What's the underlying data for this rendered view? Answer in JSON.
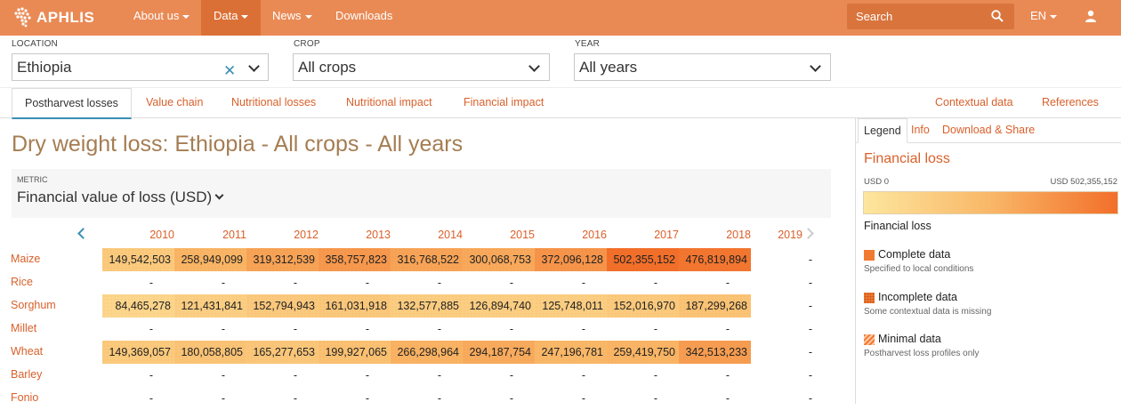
{
  "brand": {
    "name": "APHLIS"
  },
  "nav": {
    "items": [
      {
        "label": "About us",
        "dropdown": true
      },
      {
        "label": "Data",
        "dropdown": true,
        "active": true
      },
      {
        "label": "News",
        "dropdown": true
      },
      {
        "label": "Downloads",
        "dropdown": false
      }
    ],
    "search_placeholder": "Search",
    "language": "EN"
  },
  "filters": {
    "location": {
      "label": "LOCATION",
      "value": "Ethiopia"
    },
    "crop": {
      "label": "CROP",
      "value": "All crops"
    },
    "year": {
      "label": "YEAR",
      "value": "All years"
    }
  },
  "tabs": {
    "left": [
      "Postharvest losses",
      "Value chain",
      "Nutritional losses",
      "Nutritional impact",
      "Financial impact"
    ],
    "right": [
      "Contextual data",
      "References"
    ]
  },
  "main": {
    "title": "Dry weight loss: Ethiopia - All crops - All years",
    "metric_label": "METRIC",
    "metric_value": "Financial value of loss (USD)"
  },
  "table": {
    "years": [
      "2010",
      "2011",
      "2012",
      "2013",
      "2014",
      "2015",
      "2016",
      "2017",
      "2018",
      "2019"
    ],
    "rows": [
      {
        "crop": "Maize",
        "values": [
          "149,542,503",
          "258,949,099",
          "319,312,539",
          "358,757,823",
          "316,768,522",
          "300,068,753",
          "372,096,128",
          "502,355,152",
          "476,819,894",
          "-"
        ],
        "raw": [
          149542503,
          258949099,
          319312539,
          358757823,
          316768522,
          300068753,
          372096128,
          502355152,
          476819894,
          null
        ]
      },
      {
        "crop": "Rice",
        "values": [
          "-",
          "-",
          "-",
          "-",
          "-",
          "-",
          "-",
          "-",
          "-",
          "-"
        ],
        "raw": [
          null,
          null,
          null,
          null,
          null,
          null,
          null,
          null,
          null,
          null
        ]
      },
      {
        "crop": "Sorghum",
        "values": [
          "84,465,278",
          "121,431,841",
          "152,794,943",
          "161,031,918",
          "132,577,885",
          "126,894,740",
          "125,748,011",
          "152,016,970",
          "187,299,268",
          "-"
        ],
        "raw": [
          84465278,
          121431841,
          152794943,
          161031918,
          132577885,
          126894740,
          125748011,
          152016970,
          187299268,
          null
        ]
      },
      {
        "crop": "Millet",
        "values": [
          "-",
          "-",
          "-",
          "-",
          "-",
          "-",
          "-",
          "-",
          "-",
          "-"
        ],
        "raw": [
          null,
          null,
          null,
          null,
          null,
          null,
          null,
          null,
          null,
          null
        ]
      },
      {
        "crop": "Wheat",
        "values": [
          "149,369,057",
          "180,058,805",
          "165,277,653",
          "199,927,065",
          "266,298,964",
          "294,187,754",
          "247,196,781",
          "259,419,750",
          "342,513,233",
          "-"
        ],
        "raw": [
          149369057,
          180058805,
          165277653,
          199927065,
          266298964,
          294187754,
          247196781,
          259419750,
          342513233,
          null
        ]
      },
      {
        "crop": "Barley",
        "values": [
          "-",
          "-",
          "-",
          "-",
          "-",
          "-",
          "-",
          "-",
          "-",
          "-"
        ],
        "raw": [
          null,
          null,
          null,
          null,
          null,
          null,
          null,
          null,
          null,
          null
        ]
      },
      {
        "crop": "Fonio",
        "values": [
          "-",
          "-",
          "-",
          "-",
          "-",
          "-",
          "-",
          "-",
          "-",
          "-"
        ],
        "raw": [
          null,
          null,
          null,
          null,
          null,
          null,
          null,
          null,
          null,
          null
        ]
      }
    ],
    "scale_min": 0,
    "scale_max": 502355152
  },
  "legend": {
    "tabs": [
      "Legend",
      "Info",
      "Download & Share"
    ],
    "title": "Financial loss",
    "scale_low": "USD 0",
    "scale_high": "USD 502,355,152",
    "scale_caption": "Financial loss",
    "colors": {
      "low": "#fde69e",
      "mid": "#f9b767",
      "high": "#f26f2a"
    },
    "keys": [
      {
        "title": "Complete data",
        "subtitle": "Specified to local conditions",
        "pattern": "solid"
      },
      {
        "title": "Incomplete data",
        "subtitle": "Some contextual data is missing",
        "pattern": "dots"
      },
      {
        "title": "Minimal data",
        "subtitle": "Postharvest loss profiles only",
        "pattern": "stripes"
      }
    ]
  }
}
